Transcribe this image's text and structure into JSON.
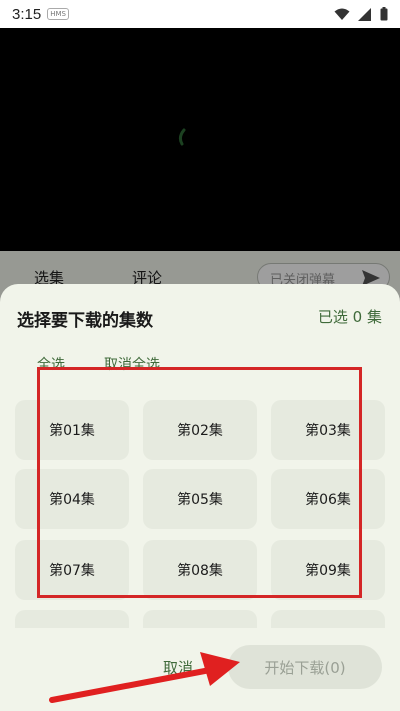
{
  "status_bar": {
    "time": "3:15",
    "badge": "HMS",
    "icons": [
      "wifi-icon",
      "signal-icon",
      "battery-icon"
    ]
  },
  "tabs": {
    "episodes": "选集",
    "comments": "评论",
    "danmaku_placeholder": "已关闭弹幕"
  },
  "sheet": {
    "title": "选择要下载的集数",
    "selected_count": "已选 0 集",
    "select_all": "全选",
    "deselect_all": "取消全选",
    "episodes": [
      "第01集",
      "第02集",
      "第03集",
      "第04集",
      "第05集",
      "第06集",
      "第07集",
      "第08集",
      "第09集"
    ],
    "cancel": "取消",
    "start_download": "开始下载(0)"
  },
  "colors": {
    "accent_green": "#3f6a3a",
    "annotation_red": "#d42626",
    "sheet_bg": "#f1f4ea"
  }
}
